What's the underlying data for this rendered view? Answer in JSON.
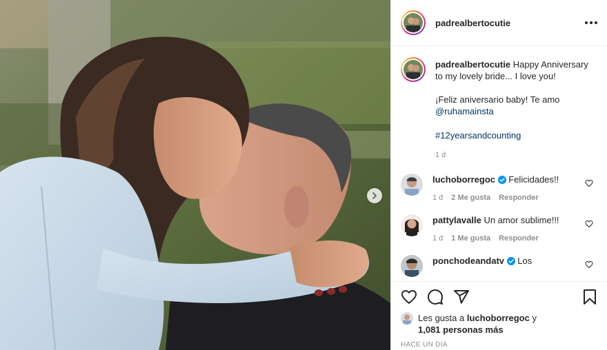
{
  "post": {
    "username": "padrealbertocutie",
    "photo_alt": "",
    "caption": {
      "username": "padrealbertocutie",
      "line1": "Happy Anniversary to my lovely bride... I love you!",
      "line2": "¡Feliz aniversario baby! Te amo",
      "mention": "@ruhamainsta",
      "hashtag": "#12yearsandcounting",
      "time": "1 d"
    },
    "comments": [
      {
        "username": "luchoborregoc",
        "verified": true,
        "text": "Felicidades!!",
        "time": "1 d",
        "likes": "2 Me gusta",
        "reply": "Responder"
      },
      {
        "username": "pattylavalle",
        "verified": false,
        "text": "Un amor sublime!!!",
        "time": "1 d",
        "likes": "1 Me gusta",
        "reply": "Responder"
      },
      {
        "username": "ponchodeandatv",
        "verified": true,
        "text": "Los",
        "time": "",
        "likes": "",
        "reply": ""
      }
    ],
    "likes": {
      "prefix": "Les gusta a",
      "user": "luchoborregoc",
      "connector": "y",
      "others": "1,081 personas más"
    },
    "date": "HACE UN DÍA",
    "icons": {
      "more": "more-options-icon",
      "next": "chevron-right-icon",
      "like": "heart-icon",
      "comment": "comment-icon",
      "share": "paper-plane-icon",
      "save": "bookmark-icon",
      "verified": "verified-badge-icon",
      "comment_like": "small-heart-icon"
    },
    "colors": {
      "link": "#00376b",
      "verified": "#0095f6",
      "muted": "#8e8e8e",
      "text": "#262626"
    }
  }
}
